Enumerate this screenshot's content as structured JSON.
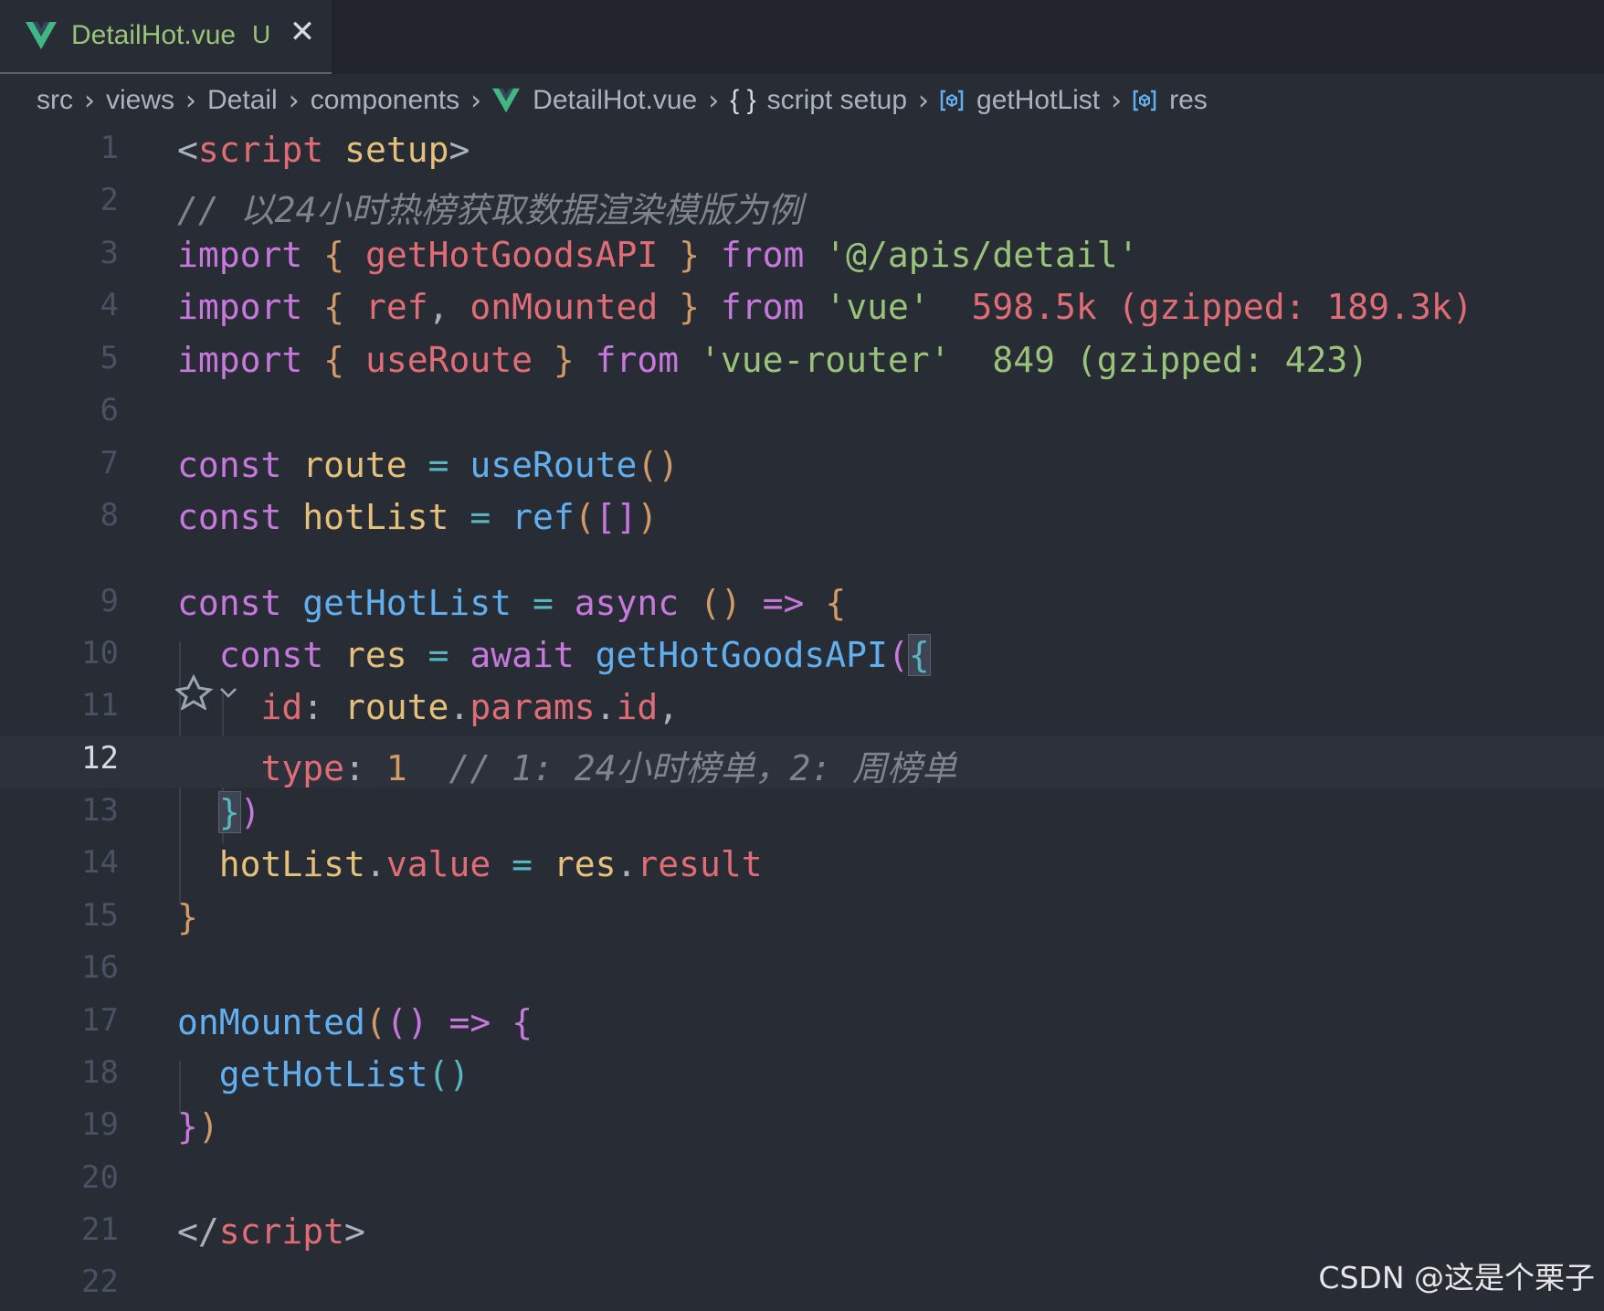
{
  "tab": {
    "file_name": "DetailHot.vue",
    "status": "U",
    "close_glyph": "✕"
  },
  "breadcrumb": {
    "items": [
      "src",
      "views",
      "Detail",
      "components",
      "DetailHot.vue",
      "script setup",
      "getHotList",
      "res"
    ],
    "braces": "{ }",
    "separator": "›"
  },
  "editor": {
    "active_line": 12,
    "line_numbers": [
      "1",
      "2",
      "3",
      "4",
      "5",
      "6",
      "7",
      "8",
      "9",
      "10",
      "11",
      "12",
      "13",
      "14",
      "15",
      "16",
      "17",
      "18",
      "19",
      "20",
      "21",
      "22"
    ],
    "lines": [
      [
        [
          "<",
          "plain"
        ],
        [
          "script",
          "t"
        ],
        [
          " ",
          "plain"
        ],
        [
          "setup",
          "v"
        ],
        [
          ">",
          "plain"
        ]
      ],
      [
        [
          "// 以24小时热榜获取数据渲染模版为例",
          "c"
        ]
      ],
      [
        [
          "import",
          "k"
        ],
        [
          " ",
          "plain"
        ],
        [
          "{",
          "br1"
        ],
        [
          " getHotGoodsAPI ",
          "p"
        ],
        [
          "}",
          "br1"
        ],
        [
          " ",
          "plain"
        ],
        [
          "from",
          "k"
        ],
        [
          " ",
          "plain"
        ],
        [
          "'@/apis/detail'",
          "s"
        ]
      ],
      [
        [
          "import",
          "k"
        ],
        [
          " ",
          "plain"
        ],
        [
          "{",
          "br1"
        ],
        [
          " ref",
          "p"
        ],
        [
          ", ",
          "plain"
        ],
        [
          "onMounted ",
          "p"
        ],
        [
          "}",
          "br1"
        ],
        [
          " ",
          "plain"
        ],
        [
          "from",
          "k"
        ],
        [
          " ",
          "plain"
        ],
        [
          "'vue'",
          "s"
        ],
        [
          "  598.5k (gzipped: 189.3k)",
          "p"
        ]
      ],
      [
        [
          "import",
          "k"
        ],
        [
          " ",
          "plain"
        ],
        [
          "{",
          "br1"
        ],
        [
          " useRoute ",
          "p"
        ],
        [
          "}",
          "br1"
        ],
        [
          " ",
          "plain"
        ],
        [
          "from",
          "k"
        ],
        [
          " ",
          "plain"
        ],
        [
          "'vue-router'",
          "s"
        ],
        [
          "  849 (gzipped: 423)",
          "s"
        ]
      ],
      [],
      [
        [
          "const",
          "k"
        ],
        [
          " ",
          "plain"
        ],
        [
          "route",
          "v"
        ],
        [
          " ",
          "plain"
        ],
        [
          "=",
          "op"
        ],
        [
          " ",
          "plain"
        ],
        [
          "useRoute",
          "f"
        ],
        [
          "()",
          "br1"
        ]
      ],
      [
        [
          "const",
          "k"
        ],
        [
          " ",
          "plain"
        ],
        [
          "hotList",
          "v"
        ],
        [
          " ",
          "plain"
        ],
        [
          "=",
          "op"
        ],
        [
          " ",
          "plain"
        ],
        [
          "ref",
          "f"
        ],
        [
          "(",
          "br1"
        ],
        [
          "[]",
          "br2"
        ],
        [
          ")",
          "br1"
        ]
      ],
      [
        [
          "const",
          "k"
        ],
        [
          " ",
          "plain"
        ],
        [
          "getHotList",
          "f"
        ],
        [
          " ",
          "plain"
        ],
        [
          "=",
          "op"
        ],
        [
          " ",
          "plain"
        ],
        [
          "async",
          "k"
        ],
        [
          " ",
          "plain"
        ],
        [
          "()",
          "br1"
        ],
        [
          " ",
          "plain"
        ],
        [
          "=>",
          "k"
        ],
        [
          " ",
          "plain"
        ],
        [
          "{",
          "br1"
        ]
      ],
      [
        [
          "  ",
          "plain"
        ],
        [
          "const",
          "k"
        ],
        [
          " ",
          "plain"
        ],
        [
          "res",
          "v"
        ],
        [
          " ",
          "plain"
        ],
        [
          "=",
          "op"
        ],
        [
          " ",
          "plain"
        ],
        [
          "await",
          "k"
        ],
        [
          " ",
          "plain"
        ],
        [
          "getHotGoodsAPI",
          "f"
        ],
        [
          "(",
          "br2"
        ],
        [
          "{",
          "br3"
        ]
      ],
      [
        [
          "    ",
          "plain"
        ],
        [
          "id",
          "p"
        ],
        [
          ": ",
          "plain"
        ],
        [
          "route",
          "v"
        ],
        [
          ".",
          "plain"
        ],
        [
          "params",
          "p"
        ],
        [
          ".",
          "plain"
        ],
        [
          "id",
          "p"
        ],
        [
          ",",
          "plain"
        ]
      ],
      [
        [
          "    ",
          "plain"
        ],
        [
          "type",
          "p"
        ],
        [
          ": ",
          "plain"
        ],
        [
          "1",
          "n"
        ],
        [
          "  ",
          "plain"
        ],
        [
          "// 1: 24小时榜单，2: 周榜单",
          "c"
        ]
      ],
      [
        [
          "  ",
          "plain"
        ],
        [
          "}",
          "br3"
        ],
        [
          ")",
          "br2"
        ]
      ],
      [
        [
          "  ",
          "plain"
        ],
        [
          "hotList",
          "v"
        ],
        [
          ".",
          "plain"
        ],
        [
          "value",
          "p"
        ],
        [
          " ",
          "plain"
        ],
        [
          "=",
          "op"
        ],
        [
          " ",
          "plain"
        ],
        [
          "res",
          "v"
        ],
        [
          ".",
          "plain"
        ],
        [
          "result",
          "p"
        ]
      ],
      [
        [
          "}",
          "br1"
        ]
      ],
      [],
      [
        [
          "onMounted",
          "f"
        ],
        [
          "(",
          "br1"
        ],
        [
          "()",
          "br2"
        ],
        [
          " ",
          "plain"
        ],
        [
          "=>",
          "k"
        ],
        [
          " ",
          "plain"
        ],
        [
          "{",
          "br2"
        ]
      ],
      [
        [
          "  ",
          "plain"
        ],
        [
          "getHotList",
          "f"
        ],
        [
          "()",
          "br3"
        ]
      ],
      [
        [
          "}",
          "br2"
        ],
        [
          ")",
          "br1"
        ]
      ],
      [],
      [
        [
          "</",
          "plain"
        ],
        [
          "script",
          "t"
        ],
        [
          ">",
          "plain"
        ]
      ],
      []
    ]
  },
  "colors": {
    "background": "#282c34",
    "tabbar": "#21252b",
    "vue_green": "#41b883",
    "keyword": "#c678dd",
    "function": "#61afef",
    "string": "#98c379",
    "property": "#e06c75"
  },
  "icons": [
    "vue-logo-icon",
    "close-icon",
    "chevron-right-icon",
    "braces-icon",
    "variable-symbol-icon",
    "codelens-ai-icon",
    "chevron-down-icon"
  ],
  "watermark": "CSDN @这是个栗子"
}
